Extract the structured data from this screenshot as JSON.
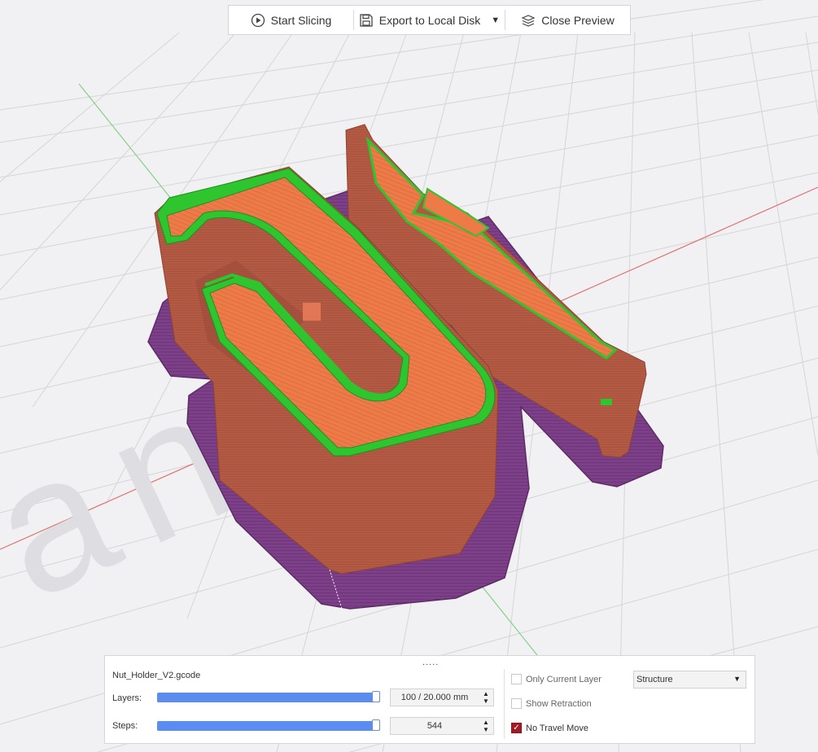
{
  "toolbar": {
    "start_slicing_label": "Start Slicing",
    "export_label": "Export to Local Disk",
    "close_preview_label": "Close Preview",
    "icons": [
      "play-circle-icon",
      "save-disk-icon",
      "dropdown-arrow-icon",
      "layers-icon"
    ]
  },
  "scene": {
    "watermark": "anker",
    "colors": {
      "background": "#f1f1f3",
      "grid": "#d5d5d8",
      "x_axis": "#e07070",
      "y_axis": "#84d084",
      "walls": "#b35a45",
      "top_infill": "#ee7a48",
      "top_outline": "#2fc52f",
      "skirt": "#7d3f88"
    }
  },
  "panel": {
    "drag_handle": ".....",
    "filename": "Nut_Holder_V2.gcode",
    "layers": {
      "label": "Layers:",
      "value": "100 / 20.000 mm",
      "fraction": 1.0
    },
    "steps": {
      "label": "Steps:",
      "value": "544",
      "fraction": 1.0
    },
    "only_current_layer": {
      "label": "Only Current Layer",
      "checked": false
    },
    "show_retraction": {
      "label": "Show Retraction",
      "checked": false
    },
    "no_travel_move": {
      "label": "No Travel Move",
      "checked": true
    },
    "view_mode": {
      "selected": "Structure"
    },
    "accent_color": "#5b8cf0"
  }
}
